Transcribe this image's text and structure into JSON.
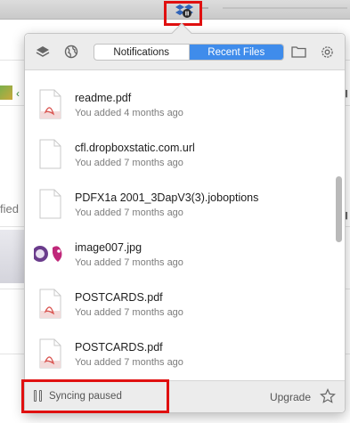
{
  "header": {
    "tabs": [
      {
        "label": "Notifications",
        "active": false
      },
      {
        "label": "Recent Files",
        "active": true
      }
    ],
    "icons": [
      "layers-icon",
      "globe-icon",
      "folder-icon",
      "gear-icon"
    ]
  },
  "files": [
    {
      "name": "readme.pdf",
      "meta": "You added 4 months ago",
      "icon": "pdf-file-icon"
    },
    {
      "name": "cfl.dropboxstatic.com.url",
      "meta": "You added 7 months ago",
      "icon": "generic-file-icon"
    },
    {
      "name": "PDFX1a 2001_3DapV3(3).joboptions",
      "meta": "You added 7 months ago",
      "icon": "generic-file-icon"
    },
    {
      "name": "image007.jpg",
      "meta": "You added 7 months ago",
      "icon": "image-thumbnail-icon"
    },
    {
      "name": "POSTCARDS.pdf",
      "meta": "You added 7 months ago",
      "icon": "pdf-file-icon"
    },
    {
      "name": "POSTCARDS.pdf",
      "meta": "You added 7 months ago",
      "icon": "pdf-file-icon"
    }
  ],
  "footer": {
    "status": "Syncing paused",
    "upgrade": "Upgrade"
  },
  "background": {
    "left_text": "fied",
    "arrow": "‹"
  },
  "colors": {
    "accent": "#3f8ceb",
    "highlight": "#e01010",
    "pdf_red": "#d9534f"
  }
}
